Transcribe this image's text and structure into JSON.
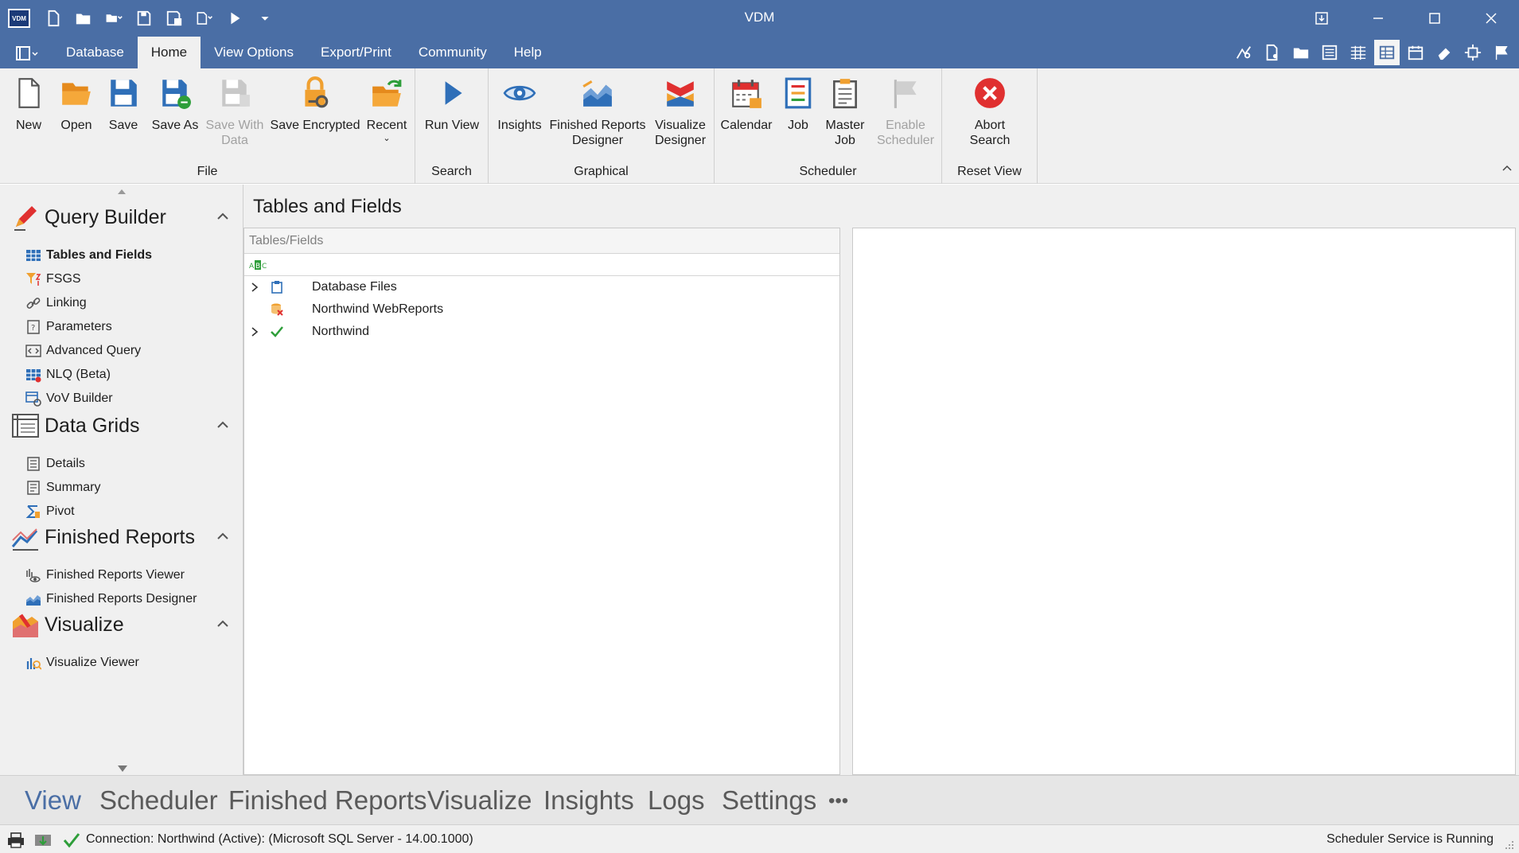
{
  "window": {
    "title": "VDM",
    "logo_text": "VDM"
  },
  "menu": {
    "tabs": [
      "Database",
      "Home",
      "View Options",
      "Export/Print",
      "Community",
      "Help"
    ],
    "active_tab": "Home"
  },
  "ribbon": {
    "groups": {
      "file": {
        "label": "File",
        "buttons": {
          "new": "New",
          "open": "Open",
          "save": "Save",
          "save_as": "Save As",
          "save_with_data": "Save With Data",
          "save_encrypted": "Save Encrypted",
          "recent": "Recent"
        }
      },
      "search": {
        "label": "Search",
        "buttons": {
          "run_view": "Run View"
        }
      },
      "graphical": {
        "label": "Graphical",
        "buttons": {
          "insights": "Insights",
          "finished_reports_designer": "Finished Reports Designer",
          "visualize_designer": "Visualize Designer"
        }
      },
      "scheduler": {
        "label": "Scheduler",
        "buttons": {
          "calendar": "Calendar",
          "job": "Job",
          "master_job": "Master Job",
          "enable_scheduler": "Enable Scheduler"
        }
      },
      "reset_view": {
        "label": "Reset View",
        "buttons": {
          "abort_search": "Abort Search"
        }
      }
    }
  },
  "sidebar": {
    "sections": {
      "query_builder": {
        "title": "Query Builder",
        "items": [
          "Tables and Fields",
          "FSGS",
          "Linking",
          "Parameters",
          "Advanced Query",
          "NLQ (Beta)",
          "VoV Builder"
        ]
      },
      "data_grids": {
        "title": "Data Grids",
        "items": [
          "Details",
          "Summary",
          "Pivot"
        ]
      },
      "finished_reports": {
        "title": "Finished Reports",
        "items": [
          "Finished Reports Viewer",
          "Finished Reports Designer"
        ]
      },
      "visualize": {
        "title": "Visualize",
        "items": [
          "Visualize Viewer"
        ]
      }
    }
  },
  "main": {
    "title": "Tables and Fields",
    "tree": {
      "header": "Tables/Fields",
      "rows": [
        {
          "label": "Database Files",
          "expandable": true,
          "icon": "database-files-icon"
        },
        {
          "label": "Northwind WebReports",
          "expandable": false,
          "icon": "database-error-icon"
        },
        {
          "label": "Northwind",
          "expandable": true,
          "icon": "checkmark-icon"
        }
      ]
    }
  },
  "bottom_nav": {
    "items": [
      "View",
      "Scheduler",
      "Finished Reports",
      "Visualize",
      "Insights",
      "Logs",
      "Settings",
      "•••"
    ],
    "active": "View"
  },
  "status": {
    "connection": "Connection: Northwind (Active): (Microsoft SQL Server - 14.00.1000)",
    "scheduler": "Scheduler Service is Running"
  },
  "colors": {
    "titlebar": "#4a6ea5",
    "ribbon_bg": "#f0f0f0",
    "accent": "#4a6ea5",
    "orange": "#f0a030",
    "blue_icon": "#2f6fb8",
    "red_icon": "#e03030",
    "green_check": "#2e9e3a"
  }
}
